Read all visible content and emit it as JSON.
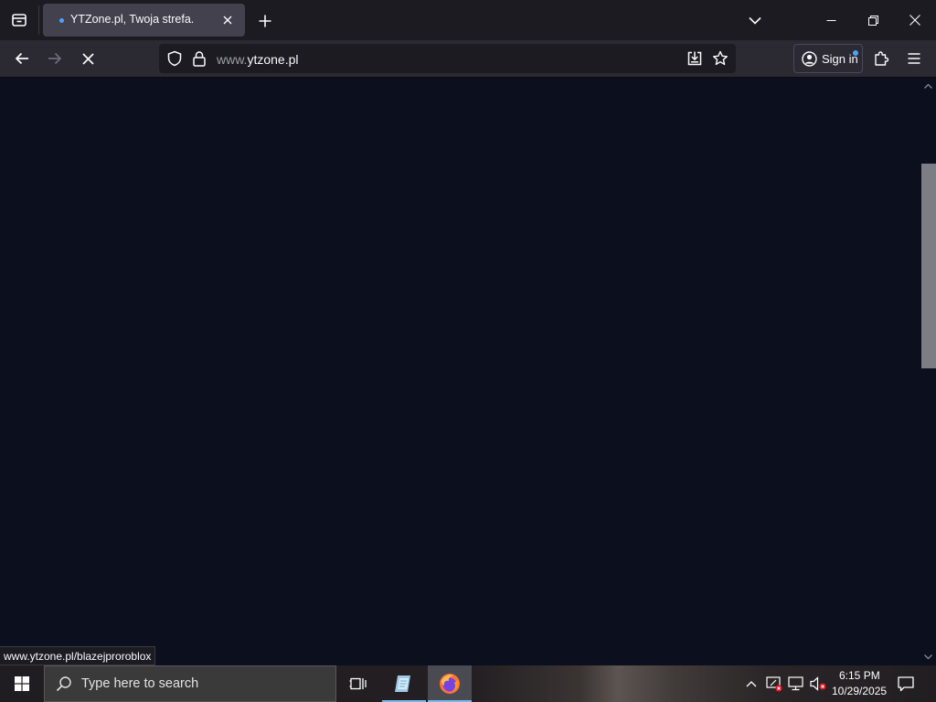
{
  "browser": {
    "tab": {
      "title": "YTZone.pl, Twoja strefa."
    },
    "url": {
      "prefix": "www.",
      "domain": "ytzone.pl"
    },
    "sign_in_label": "Sign in",
    "status_link": "www.ytzone.pl/blazejproroblox",
    "page_loading": true
  },
  "taskbar": {
    "search_placeholder": "Type here to search",
    "clock": {
      "time": "6:15 PM",
      "date": "10/29/2025"
    }
  },
  "icons": {
    "tab_list": "tab-list-icon",
    "new_tab": "plus-icon",
    "back": "arrow-left-icon",
    "forward": "arrow-right-icon",
    "stop": "stop-x-icon",
    "tracking": "shield-icon",
    "lock": "lock-icon",
    "install": "download-app-icon",
    "bookmark": "star-icon",
    "account": "account-icon",
    "extensions": "puzzle-icon",
    "menu": "hamburger-icon",
    "windows": "windows-logo-icon",
    "task_view": "task-view-icon",
    "firefox": "firefox-icon"
  },
  "colors": {
    "content_bg": "#0c0f1e",
    "tab_strip": "#1c1b22",
    "toolbar": "#2b2a33",
    "accent_dot": "#4aa3ff",
    "taskbar_accent": "#76b9ed"
  }
}
